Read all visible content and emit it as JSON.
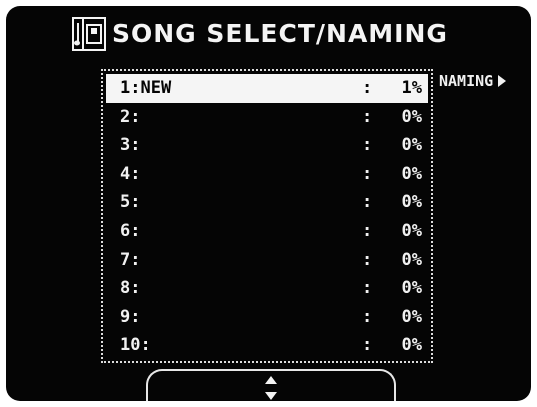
{
  "header": {
    "title": "SONG SELECT/NAMING"
  },
  "naming": {
    "label": "NAMING"
  },
  "songs": [
    {
      "number": "1:NEW",
      "sep": ":",
      "percent": "1%",
      "selected": true
    },
    {
      "number": "2:",
      "sep": ":",
      "percent": "0%",
      "selected": false
    },
    {
      "number": "3:",
      "sep": ":",
      "percent": "0%",
      "selected": false
    },
    {
      "number": "4:",
      "sep": ":",
      "percent": "0%",
      "selected": false
    },
    {
      "number": "5:",
      "sep": ":",
      "percent": "0%",
      "selected": false
    },
    {
      "number": "6:",
      "sep": ":",
      "percent": "0%",
      "selected": false
    },
    {
      "number": "7:",
      "sep": ":",
      "percent": "0%",
      "selected": false
    },
    {
      "number": "8:",
      "sep": ":",
      "percent": "0%",
      "selected": false
    },
    {
      "number": "9:",
      "sep": ":",
      "percent": "0%",
      "selected": false
    },
    {
      "number": "10:",
      "sep": ":",
      "percent": "0%",
      "selected": false
    }
  ],
  "icons": {
    "header_icon": "disk-icon",
    "naming_arrow": "arrow-right-icon",
    "scroll": "up-down-arrows-icon"
  },
  "colors": {
    "screen_bg": "#050505",
    "text": "#f1f1f1",
    "highlight": "#f5f5f5"
  }
}
